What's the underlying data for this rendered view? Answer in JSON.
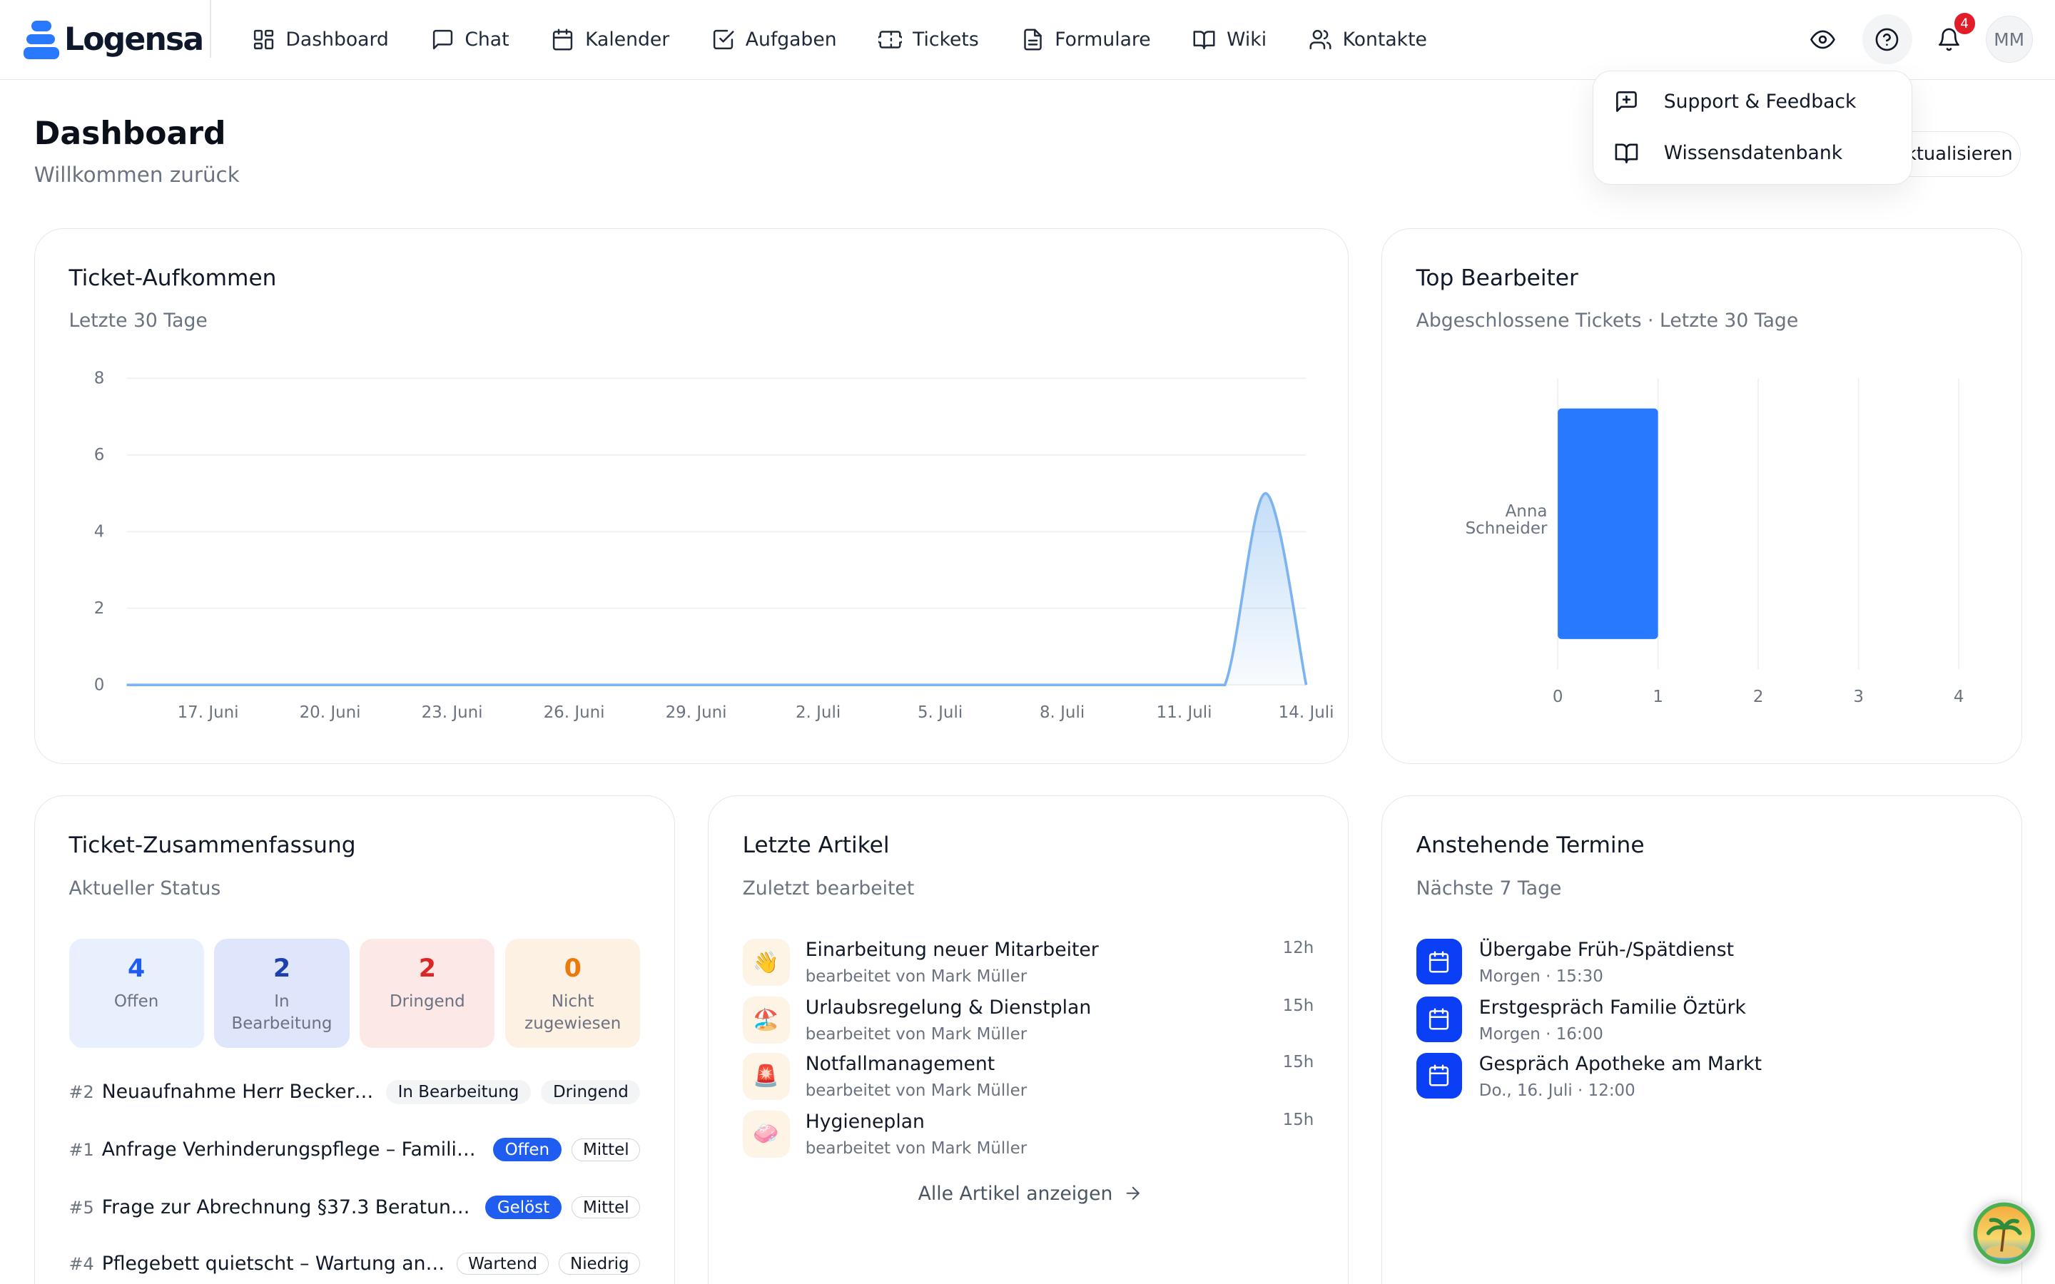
{
  "brand": {
    "name": "Logensa",
    "color": "#2979ff"
  },
  "nav": [
    {
      "label": "Dashboard",
      "icon": "grid-icon"
    },
    {
      "label": "Chat",
      "icon": "chat-icon"
    },
    {
      "label": "Kalender",
      "icon": "calendar-icon"
    },
    {
      "label": "Aufgaben",
      "icon": "checkbox-icon"
    },
    {
      "label": "Tickets",
      "icon": "ticket-icon"
    },
    {
      "label": "Formulare",
      "icon": "form-icon"
    },
    {
      "label": "Wiki",
      "icon": "book-icon"
    },
    {
      "label": "Kontakte",
      "icon": "contacts-icon"
    }
  ],
  "topbar": {
    "notification_count": "4",
    "avatar_initials": "MM"
  },
  "help_menu": {
    "items": [
      {
        "label": "Support & Feedback",
        "icon": "message-plus-icon"
      },
      {
        "label": "Wissensdatenbank",
        "icon": "book-icon"
      }
    ]
  },
  "page": {
    "title": "Dashboard",
    "subtitle": "Willkommen zurück",
    "refresh_label": "ktualisieren"
  },
  "ticket_volume": {
    "title": "Ticket-Aufkommen",
    "subtitle": "Letzte 30 Tage"
  },
  "top_agents": {
    "title": "Top Bearbeiter",
    "subtitle": "Abgeschlossene Tickets · Letzte 30 Tage"
  },
  "chart_data": [
    {
      "type": "area",
      "x": [
        "15. Juni",
        "16. Juni",
        "17. Juni",
        "18. Juni",
        "19. Juni",
        "20. Juni",
        "21. Juni",
        "22. Juni",
        "23. Juni",
        "24. Juni",
        "25. Juni",
        "26. Juni",
        "27. Juni",
        "28. Juni",
        "29. Juni",
        "30. Juni",
        "1. Juli",
        "2. Juli",
        "3. Juli",
        "4. Juli",
        "5. Juli",
        "6. Juli",
        "7. Juli",
        "8. Juli",
        "9. Juli",
        "10. Juli",
        "11. Juli",
        "12. Juli",
        "13. Juli",
        "14. Juli"
      ],
      "values": [
        0,
        0,
        0,
        0,
        0,
        0,
        0,
        0,
        0,
        0,
        0,
        0,
        0,
        0,
        0,
        0,
        0,
        0,
        0,
        0,
        0,
        0,
        0,
        0,
        0,
        0,
        0,
        0,
        5,
        0
      ],
      "xticks": [
        "17. Juni",
        "20. Juni",
        "23. Juni",
        "26. Juni",
        "29. Juni",
        "2. Juli",
        "5. Juli",
        "8. Juli",
        "11. Juli",
        "14. Juli"
      ],
      "yticks": [
        0,
        2,
        4,
        6,
        8
      ],
      "ylim": [
        0,
        8
      ],
      "grid": true,
      "color": "#7bb4f0"
    },
    {
      "type": "bar",
      "orientation": "horizontal",
      "categories": [
        [
          "Anna",
          "Schneider"
        ]
      ],
      "values": [
        1
      ],
      "xticks": [
        0,
        1,
        2,
        3,
        4
      ],
      "xlim": [
        0,
        4
      ],
      "grid": true,
      "color": "#2979ff"
    }
  ],
  "summary": {
    "title": "Ticket-Zusammenfassung",
    "subtitle": "Aktueller Status",
    "stats": [
      {
        "value": "4",
        "label": "Offen",
        "bg": "#e8f0fe",
        "fg": "#1f5cf0"
      },
      {
        "value": "2",
        "label": "In Bearbeitung",
        "bg": "#dfe6fb",
        "fg": "#1e40af"
      },
      {
        "value": "2",
        "label": "Dringend",
        "bg": "#fde8e8",
        "fg": "#dc2626"
      },
      {
        "value": "0",
        "label": "Nicht zugewiesen",
        "bg": "#fdf1e3",
        "fg": "#ea7a0c"
      }
    ],
    "tickets": [
      {
        "id": "#2",
        "title": "Neuaufnahme Herr Becker z...",
        "status": "In Bearbeitung",
        "status_style": "grey",
        "priority": "Dringend",
        "priority_style": "grey"
      },
      {
        "id": "#1",
        "title": "Anfrage Verhinderungspflege – Familie ...",
        "status": "Offen",
        "status_style": "blue",
        "priority": "Mittel",
        "priority_style": "outline"
      },
      {
        "id": "#5",
        "title": "Frage zur Abrechnung §37.3 Beratungs...",
        "status": "Gelöst",
        "status_style": "blue",
        "priority": "Mittel",
        "priority_style": "outline"
      },
      {
        "id": "#4",
        "title": "Pflegebett quietscht – Wartung anf...",
        "status": "Wartend",
        "status_style": "outline",
        "priority": "Niedrig",
        "priority_style": "outline"
      }
    ]
  },
  "articles": {
    "title": "Letzte Artikel",
    "subtitle": "Zuletzt bearbeitet",
    "items": [
      {
        "emoji": "👋",
        "title": "Einarbeitung neuer Mitarbeiter",
        "by": "bearbeitet von Mark Müller",
        "age": "12h"
      },
      {
        "emoji": "🏖️",
        "title": "Urlaubsregelung & Dienstplan",
        "by": "bearbeitet von Mark Müller",
        "age": "15h"
      },
      {
        "emoji": "🚨",
        "title": "Notfallmanagement",
        "by": "bearbeitet von Mark Müller",
        "age": "15h"
      },
      {
        "emoji": "🧼",
        "title": "Hygieneplan",
        "by": "bearbeitet von Mark Müller",
        "age": "15h"
      }
    ],
    "all_link": "Alle Artikel anzeigen"
  },
  "events": {
    "title": "Anstehende Termine",
    "subtitle": "Nächste 7 Tage",
    "items": [
      {
        "title": "Übergabe Früh-/Spätdienst",
        "when": "Morgen · 15:30"
      },
      {
        "title": "Erstgespräch Familie Öztürk",
        "when": "Morgen · 16:00"
      },
      {
        "title": "Gespräch Apotheke am Markt",
        "when": "Do., 16. Juli · 12:00"
      }
    ]
  }
}
